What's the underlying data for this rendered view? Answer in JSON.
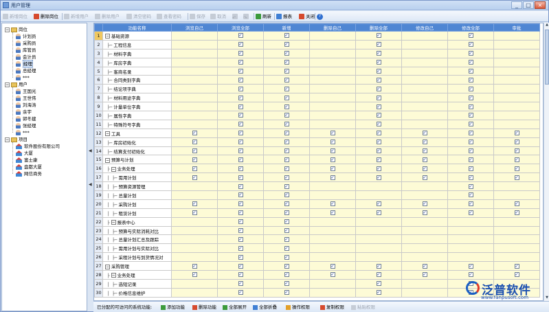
{
  "window": {
    "title": "用户管理",
    "min": "_",
    "max": "□",
    "close": "×"
  },
  "toolbar": [
    {
      "label": "新增岗位",
      "enabled": false,
      "icon": "add-icon"
    },
    {
      "label": "删除岗位",
      "enabled": true,
      "icon": "delete-icon"
    },
    {
      "label": "新增用户",
      "enabled": false,
      "icon": "add-user-icon"
    },
    {
      "label": "删除用户",
      "enabled": false,
      "icon": "delete-user-icon"
    },
    {
      "label": "清空密码",
      "enabled": false,
      "icon": "clear-password-icon"
    },
    {
      "label": "查看密码",
      "enabled": false,
      "icon": "view-password-icon"
    },
    {
      "label": "保存",
      "enabled": false,
      "icon": "save-icon"
    },
    {
      "label": "取消",
      "enabled": false,
      "icon": "cancel-icon"
    },
    {
      "label": "",
      "enabled": false,
      "icon": "undo-icon"
    },
    {
      "label": "",
      "enabled": false,
      "icon": "redo-icon"
    },
    {
      "label": "刷新",
      "enabled": true,
      "icon": "refresh-icon"
    },
    {
      "label": "报表",
      "enabled": true,
      "icon": "report-icon"
    },
    {
      "label": "关闭",
      "enabled": true,
      "icon": "close-icon"
    },
    {
      "label": "",
      "enabled": true,
      "icon": "help-icon"
    }
  ],
  "tree": {
    "positions": {
      "label": "岗位",
      "items": [
        "计划员",
        "采购员",
        "库管员",
        "会计员",
        "经理",
        "总经理",
        "***"
      ]
    },
    "users": {
      "label": "用户",
      "items": [
        "王国光",
        "王世伟",
        "刘海涛",
        "余宇",
        "郭冬建",
        "张经理",
        "***"
      ]
    },
    "projects": {
      "label": "项目",
      "items": [
        "软件股份有限公司",
        "大厦",
        "富士康",
        "盘都大厦",
        "网信商务"
      ]
    }
  },
  "grid": {
    "columns": [
      "功能名称",
      "浏览自己",
      "浏览全部",
      "新增",
      "删除自己",
      "删除全部",
      "修改自己",
      "修改全部",
      "审批"
    ],
    "rows": [
      {
        "n": "1",
        "name": "基础资源",
        "lvl": 0,
        "exp": "−",
        "c": [
          0,
          1,
          1,
          1,
          0,
          1,
          0
        ]
      },
      {
        "n": "2",
        "name": "工程信息",
        "lvl": 1,
        "c": [
          0,
          1,
          1,
          1,
          0,
          1,
          0
        ]
      },
      {
        "n": "3",
        "name": "材料字典",
        "lvl": 1,
        "c": [
          0,
          1,
          1,
          1,
          0,
          1,
          0
        ]
      },
      {
        "n": "4",
        "name": "库房字典",
        "lvl": 1,
        "c": [
          0,
          1,
          1,
          1,
          0,
          1,
          0
        ]
      },
      {
        "n": "5",
        "name": "客商名录",
        "lvl": 1,
        "c": [
          0,
          1,
          1,
          1,
          0,
          1,
          0
        ]
      },
      {
        "n": "6",
        "name": "合同类别字典",
        "lvl": 1,
        "c": [
          0,
          1,
          1,
          1,
          0,
          1,
          0
        ]
      },
      {
        "n": "7",
        "name": "结论项字典",
        "lvl": 1,
        "c": [
          0,
          1,
          1,
          1,
          0,
          1,
          0
        ]
      },
      {
        "n": "8",
        "name": "材料用途字典",
        "lvl": 1,
        "c": [
          0,
          1,
          1,
          1,
          0,
          1,
          0
        ]
      },
      {
        "n": "9",
        "name": "计量单位字典",
        "lvl": 1,
        "c": [
          0,
          1,
          1,
          1,
          0,
          1,
          0
        ]
      },
      {
        "n": "10",
        "name": "属性字典",
        "lvl": 1,
        "c": [
          0,
          1,
          1,
          1,
          0,
          1,
          0
        ]
      },
      {
        "n": "11",
        "name": "特殊符号字典",
        "lvl": 1,
        "c": [
          0,
          1,
          1,
          1,
          0,
          1,
          0
        ]
      },
      {
        "n": "12",
        "name": "工具",
        "lvl": 0,
        "exp": "−",
        "c": [
          1,
          1,
          1,
          1,
          1,
          1,
          1
        ]
      },
      {
        "n": "13",
        "name": "库房初始化",
        "lvl": 1,
        "c": [
          1,
          1,
          1,
          1,
          1,
          1,
          1
        ]
      },
      {
        "n": "14",
        "name": "结算支付初始化",
        "lvl": 1,
        "c": [
          1,
          1,
          1,
          1,
          1,
          1,
          1
        ]
      },
      {
        "n": "15",
        "name": "预算与计划",
        "lvl": 0,
        "exp": "−",
        "c": [
          1,
          1,
          1,
          1,
          1,
          1,
          1
        ]
      },
      {
        "n": "16",
        "name": "业务处理",
        "lvl": 1,
        "exp": "−",
        "c": [
          1,
          1,
          1,
          1,
          1,
          1,
          1
        ]
      },
      {
        "n": "17",
        "name": "需用计划",
        "lvl": 2,
        "c": [
          1,
          1,
          1,
          1,
          1,
          1,
          1
        ]
      },
      {
        "n": "18",
        "name": "预算资源管理",
        "lvl": 2,
        "c": [
          0,
          1,
          0,
          0,
          0,
          1,
          0
        ]
      },
      {
        "n": "19",
        "name": "总量计划",
        "lvl": 2,
        "c": [
          0,
          1,
          0,
          0,
          0,
          1,
          0
        ]
      },
      {
        "n": "20",
        "name": "采购计划",
        "lvl": 2,
        "c": [
          1,
          1,
          1,
          1,
          1,
          1,
          1
        ]
      },
      {
        "n": "21",
        "name": "租赁计划",
        "lvl": 2,
        "c": [
          1,
          1,
          1,
          1,
          1,
          1,
          1
        ]
      },
      {
        "n": "22",
        "name": "报表中心",
        "lvl": 1,
        "exp": "−",
        "c": [
          0,
          1,
          0,
          0,
          0,
          0,
          0
        ]
      },
      {
        "n": "23",
        "name": "预算与实际消耗对比",
        "lvl": 2,
        "c": [
          0,
          1,
          0,
          0,
          0,
          0,
          0
        ]
      },
      {
        "n": "24",
        "name": "总量计划汇总及跟踪",
        "lvl": 2,
        "c": [
          0,
          1,
          0,
          0,
          0,
          0,
          0
        ]
      },
      {
        "n": "25",
        "name": "需用计划与实际对比",
        "lvl": 2,
        "c": [
          0,
          1,
          0,
          0,
          0,
          0,
          0
        ]
      },
      {
        "n": "26",
        "name": "采租计划与到货情况对",
        "lvl": 2,
        "c": [
          0,
          1,
          0,
          0,
          0,
          0,
          0
        ]
      },
      {
        "n": "27",
        "name": "采购管理",
        "lvl": 0,
        "exp": "−",
        "c": [
          1,
          1,
          1,
          1,
          1,
          1,
          1
        ]
      },
      {
        "n": "28",
        "name": "业务处理",
        "lvl": 1,
        "exp": "−",
        "c": [
          1,
          1,
          1,
          1,
          1,
          1,
          1
        ]
      },
      {
        "n": "29",
        "name": "选短记录",
        "lvl": 2,
        "c": [
          0,
          1,
          1,
          1,
          0,
          1,
          0
        ]
      },
      {
        "n": "30",
        "name": "价格信息维护",
        "lvl": 2,
        "c": [
          0,
          1,
          1,
          1,
          0,
          1,
          0
        ]
      }
    ]
  },
  "bottom": {
    "summary": "已分配的可访问的系统功能:",
    "buttons": [
      {
        "label": "添加功能",
        "enabled": true,
        "icon": "add-function-icon"
      },
      {
        "label": "删除功能",
        "enabled": true,
        "icon": "delete-function-icon"
      },
      {
        "label": "全部展开",
        "enabled": true,
        "icon": "expand-all-icon"
      },
      {
        "label": "全部折叠",
        "enabled": true,
        "icon": "collapse-all-icon"
      },
      {
        "label": "操作权限",
        "enabled": true,
        "icon": "permission-icon"
      },
      {
        "label": "复制权限",
        "enabled": true,
        "icon": "copy-permission-icon"
      },
      {
        "label": "粘贴权限",
        "enabled": false,
        "icon": "paste-permission-icon"
      }
    ]
  },
  "logo": {
    "text": "泛普软件",
    "url": "www.fanpusoft.com"
  },
  "colors": {
    "header": "#4f86d3",
    "checkbox_cell": "#fdfbd6",
    "selected_row": "#f0c860"
  }
}
